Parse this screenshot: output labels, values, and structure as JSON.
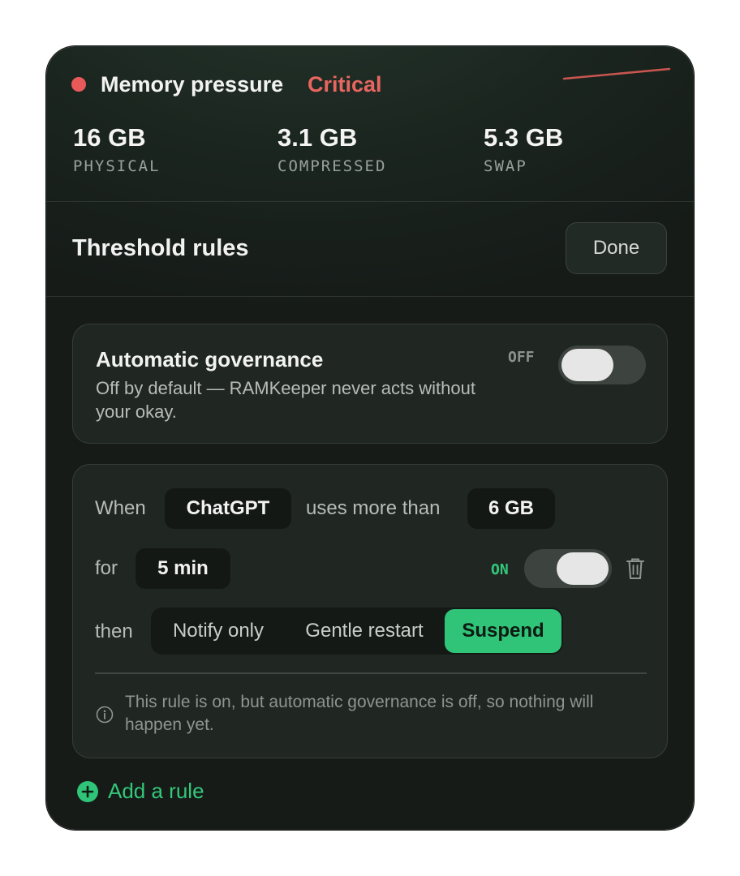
{
  "header": {
    "title": "Memory pressure",
    "status": "Critical",
    "status_color": "#e8665f"
  },
  "stats": [
    {
      "value": "16 GB",
      "label": "PHYSICAL"
    },
    {
      "value": "3.1 GB",
      "label": "COMPRESSED"
    },
    {
      "value": "5.3 GB",
      "label": "SWAP"
    }
  ],
  "section": {
    "title": "Threshold rules",
    "done_label": "Done"
  },
  "governance": {
    "title": "Automatic governance",
    "description": "Off by default — RAMKeeper never acts without your okay.",
    "toggle_label": "OFF",
    "enabled": false
  },
  "rule": {
    "when_label": "When",
    "app": "ChatGPT",
    "condition_label": "uses more than",
    "threshold": "6 GB",
    "for_label": "for",
    "duration": "5 min",
    "toggle_label": "ON",
    "enabled": true,
    "then_label": "then",
    "actions": [
      "Notify only",
      "Gentle restart",
      "Suspend"
    ],
    "selected_action": "Suspend",
    "info": "This rule is on, but automatic governance is off, so nothing will happen yet."
  },
  "add_rule_label": "Add a rule",
  "colors": {
    "accent_green": "#2fc478",
    "critical_red": "#e8595a"
  },
  "icons": {
    "status": "status-dot-icon",
    "delete": "trash-icon",
    "info": "info-icon",
    "add": "plus-circle-icon"
  }
}
